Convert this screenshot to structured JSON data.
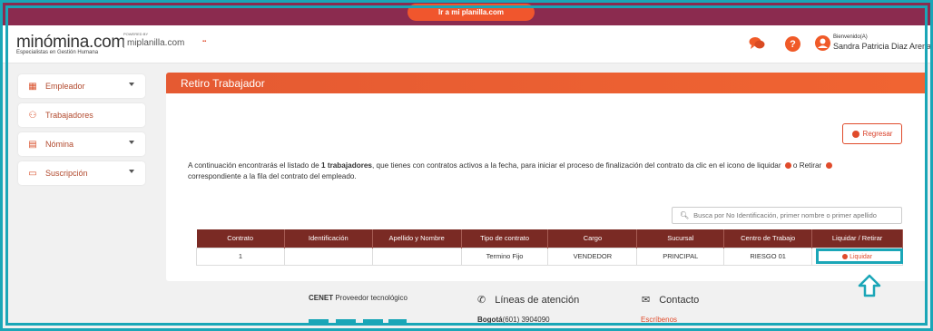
{
  "topbar": {
    "button_label": "Ir a mi planilla.com"
  },
  "header": {
    "logo_main": "minómina.com",
    "logo_sub": "Especialistas en Gestión Humana",
    "powered_by": "POWERED BY",
    "miplanilla": "miplanilla.com",
    "welcome": "Bienvenido(A)",
    "username": "Sandra Patricia Diaz Arenas"
  },
  "sidebar": {
    "items": [
      {
        "label": "Empleador",
        "icon": "building-icon"
      },
      {
        "label": "Trabajadores",
        "icon": "users-icon"
      },
      {
        "label": "Nómina",
        "icon": "document-icon"
      },
      {
        "label": "Suscripción",
        "icon": "card-icon"
      }
    ]
  },
  "panel": {
    "title": "Retiro Trabajador",
    "back_button": "Regresar",
    "intro_1": "A continuación encontrarás el listado de ",
    "intro_bold": "1 trabajadores",
    "intro_2": ", que tienes con contratos activos a la fecha, para iniciar el proceso de finalización del contrato da clic en el icono de liquidar",
    "intro_3": "o Retirar",
    "intro_4": "correspondiente a la fila del contrato del empleado.",
    "search_placeholder": "Busca por No Identificación, primer nombre o primer apellido"
  },
  "table": {
    "headers": [
      "Contrato",
      "Identificación",
      "Apellido y Nombre",
      "Tipo de contrato",
      "Cargo",
      "Sucursal",
      "Centro de Trabajo",
      "Liquidar / Retirar"
    ],
    "rows": [
      [
        "1",
        "",
        "",
        "Termino Fijo",
        "VENDEDOR",
        "PRINCIPAL",
        "RIESGO 01",
        "Liquidar"
      ]
    ]
  },
  "footer": {
    "cenet_bold": "CENET",
    "cenet_rest": " Proveedor tecnológico",
    "lines": "Líneas de atención",
    "contact": "Contacto",
    "bogota_bold": "Bogotá",
    "bogota_rest": "(601) 3904090",
    "escribenos": "Escríbenos"
  },
  "colors": {
    "accent": "#f05a28",
    "topbar": "#8b2b4f",
    "table_header": "#7a2a24",
    "highlight": "#1aa6b7"
  }
}
